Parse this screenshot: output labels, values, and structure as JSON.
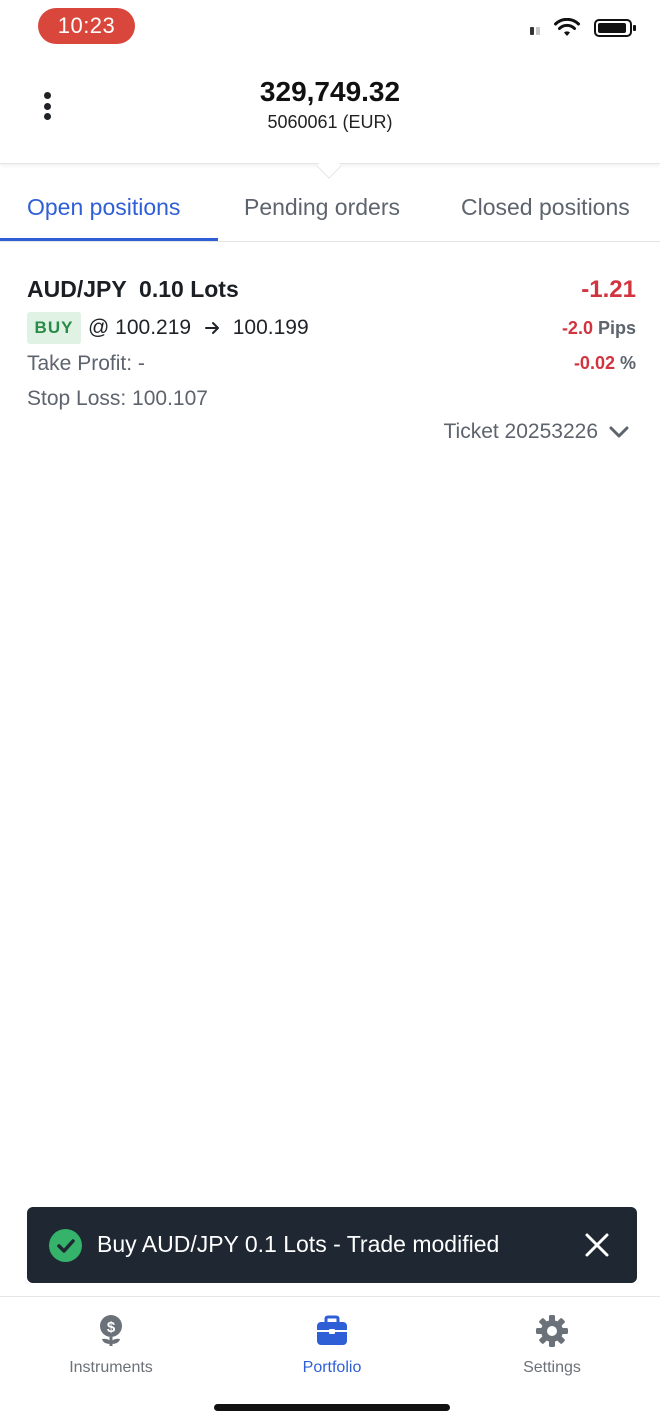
{
  "status_bar": {
    "time": "10:23"
  },
  "header": {
    "balance": "329,749.32",
    "account": "5060061 (EUR)"
  },
  "tabs": [
    {
      "label": "Open positions",
      "active": true
    },
    {
      "label": "Pending orders",
      "active": false
    },
    {
      "label": "Closed positions",
      "active": false
    }
  ],
  "position": {
    "symbol": "AUD/JPY  0.10 Lots",
    "profit_loss": "-1.21",
    "side": "BUY",
    "open_price": "@ 100.219",
    "current_price": "100.199",
    "pips_value": "-2.0",
    "pips_unit": "Pips",
    "percent_value": "-0.02",
    "percent_unit": "%",
    "take_profit": "Take Profit: -",
    "stop_loss": "Stop Loss: 100.107",
    "ticket": "Ticket 20253226"
  },
  "toast": {
    "message": "Buy AUD/JPY 0.1 Lots - Trade modified"
  },
  "bottom_nav": [
    {
      "label": "Instruments",
      "icon": "money-plant-icon",
      "active": false
    },
    {
      "label": "Portfolio",
      "icon": "briefcase-icon",
      "active": true
    },
    {
      "label": "Settings",
      "icon": "gear-icon",
      "active": false
    }
  ],
  "colors": {
    "accent": "#2f5fd6",
    "negative": "#d2343f",
    "buy": "#2a8a47",
    "toast_bg": "#1e2732",
    "time_pill": "#d9473c"
  }
}
